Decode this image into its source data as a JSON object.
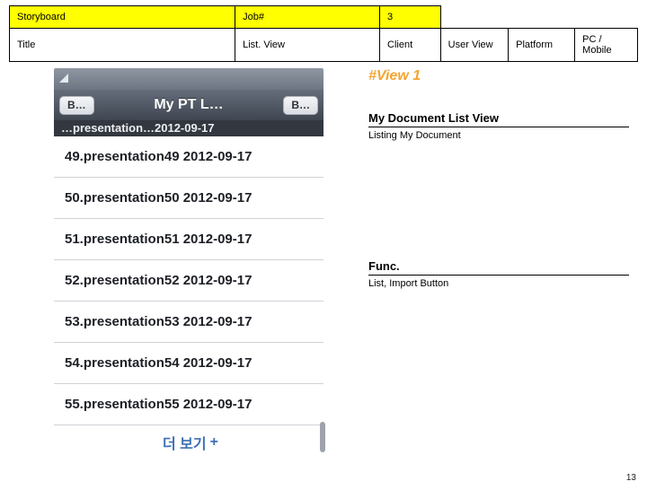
{
  "header": {
    "storyboard_label": "Storyboard",
    "job_label": "Job#",
    "job_value": "3",
    "title_label": "Title",
    "title_value": "List. View",
    "client_label": "Client",
    "client_value": "User View",
    "platform_label": "Platform",
    "platform_value": "PC / Mobile"
  },
  "phone": {
    "nav_back": "B…",
    "nav_title": "My PT L…",
    "nav_right": "B…",
    "cutoff_row": "…presentation…2012-09-17",
    "rows": [
      "49.presentation49 2012-09-17",
      "50.presentation50 2012-09-17",
      "51.presentation51 2012-09-17",
      "52.presentation52 2012-09-17",
      "53.presentation53 2012-09-17",
      "54.presentation54 2012-09-17",
      "55.presentation55 2012-09-17"
    ],
    "more": "더 보기",
    "more_plus": "+"
  },
  "ann": {
    "view_tag": "#View 1",
    "sec1_title": "My Document List View",
    "sec1_body": "Listing My Document",
    "sec2_title": "Func.",
    "sec2_body": "List, Import Button"
  },
  "page_number": "13"
}
